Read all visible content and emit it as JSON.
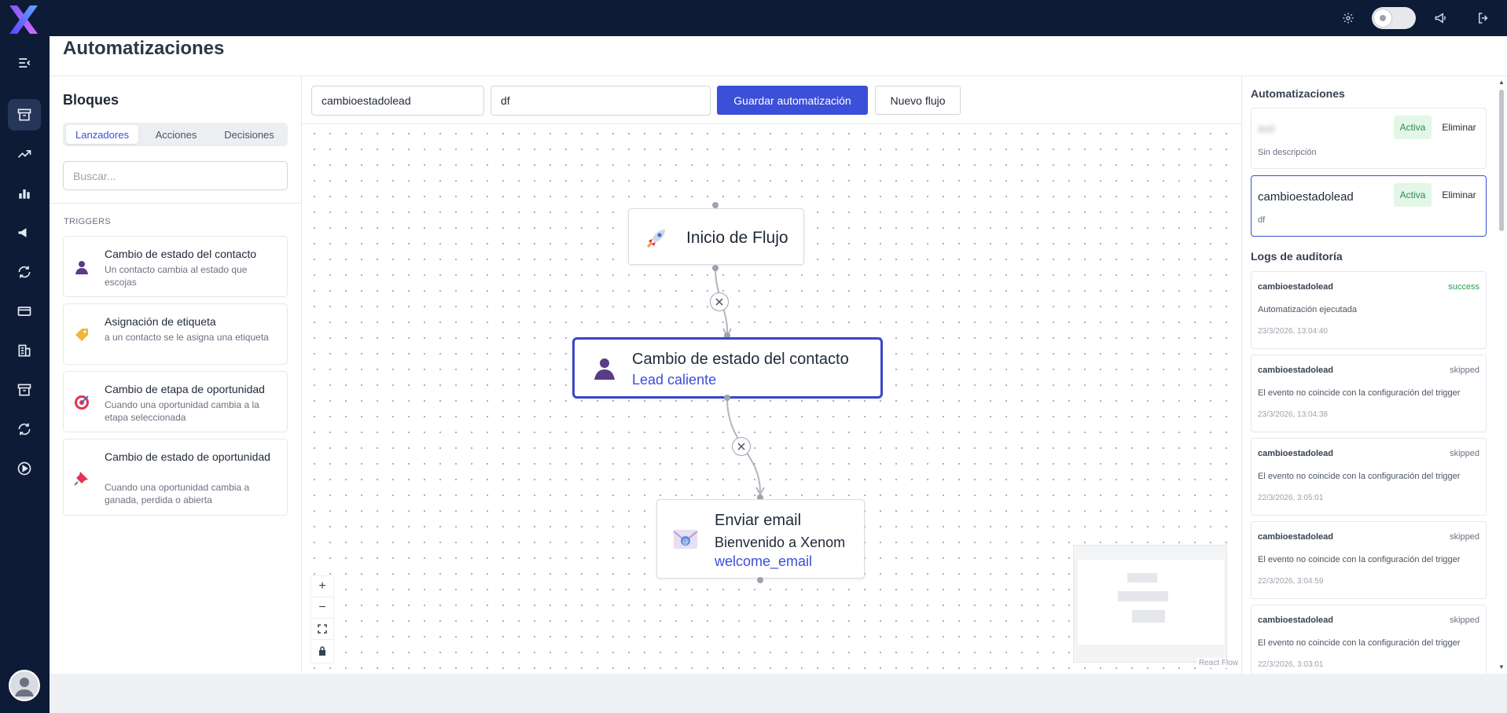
{
  "header": {
    "page_title": "Automatizaciones"
  },
  "left_panel": {
    "title": "Bloques",
    "tabs": [
      "Lanzadores",
      "Acciones",
      "Decisiones"
    ],
    "active_tab": "Lanzadores",
    "search_placeholder": "Buscar...",
    "section_label": "TRIGGERS",
    "triggers": [
      {
        "name": "Cambio de estado del contacto",
        "desc": "Un contacto cambia al estado que escojas",
        "icon": "person-icon"
      },
      {
        "name": "Asignación de etiqueta",
        "desc": "a un contacto se le asigna una etiqueta",
        "icon": "tag-icon"
      },
      {
        "name": "Cambio de etapa de oportunidad",
        "desc": "Cuando una oportunidad cambia a la etapa seleccionada",
        "icon": "target-icon"
      },
      {
        "name": "Cambio de estado de oportunidad",
        "desc": "Cuando una oportunidad cambia a ganada, perdida o abierta",
        "icon": "pushpin-icon"
      }
    ]
  },
  "toolbar": {
    "name_value": "cambioestadolead",
    "desc_value": "df",
    "save_label": "Guardar automatización",
    "new_label": "Nuevo flujo"
  },
  "flow": {
    "start": {
      "title": "Inicio de Flujo",
      "icon": "rocket-icon"
    },
    "trigger": {
      "title": "Cambio de estado del contacto",
      "subtitle": "Lead caliente",
      "icon": "person-icon"
    },
    "action": {
      "title": "Enviar email",
      "subtitle": "Bienvenido a Xenom",
      "template": "welcome_email",
      "icon": "email-icon"
    },
    "attribution": "React Flow"
  },
  "right_panel": {
    "automations_title": "Automatizaciones",
    "automations": [
      {
        "name": "asd",
        "status": "Activa",
        "delete": "Eliminar",
        "desc": "Sin descripción",
        "blurred": true
      },
      {
        "name": "cambioestadolead",
        "status": "Activa",
        "delete": "Eliminar",
        "desc": "df",
        "blurred": false
      }
    ],
    "logs_title": "Logs de auditoría",
    "logs": [
      {
        "name": "cambioestadolead",
        "status": "success",
        "message": "Automatización ejecutada",
        "date": "23/3/2026, 13:04:40"
      },
      {
        "name": "cambioestadolead",
        "status": "skipped",
        "message": "El evento no coincide con la configuración del trigger",
        "date": "23/3/2026, 13:04:38"
      },
      {
        "name": "cambioestadolead",
        "status": "skipped",
        "message": "El evento no coincide con la configuración del trigger",
        "date": "22/3/2026, 3:05:01"
      },
      {
        "name": "cambioestadolead",
        "status": "skipped",
        "message": "El evento no coincide con la configuración del trigger",
        "date": "22/3/2026, 3:04:59"
      },
      {
        "name": "cambioestadolead",
        "status": "skipped",
        "message": "El evento no coincide con la configuración del trigger",
        "date": "22/3/2026, 3:03:01"
      }
    ]
  },
  "colors": {
    "primary": "#3b4fd8",
    "nav_bg": "#0d1b36",
    "success": "#2e9a4e"
  }
}
